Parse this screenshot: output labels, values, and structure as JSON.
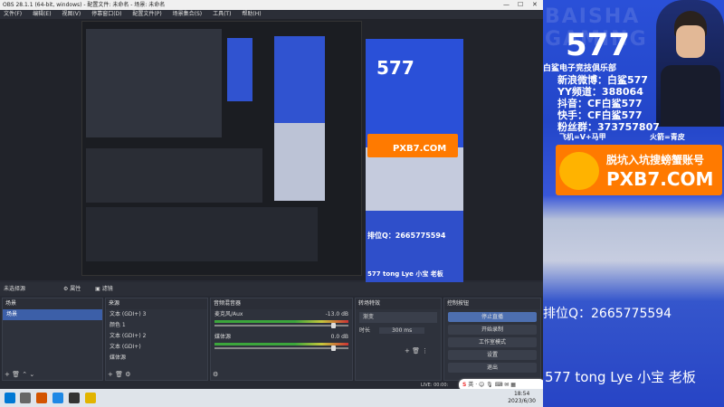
{
  "window": {
    "title": "OBS 28.1.1 (64-bit, windows) - 配置文件: 未命名 - 场景: 未命名"
  },
  "menu": [
    "文件(F)",
    "编辑(E)",
    "视图(V)",
    "停靠窗口(D)",
    "配置文件(P)",
    "场景集合(S)",
    "工具(T)",
    "帮助(H)"
  ],
  "source_bar": {
    "label": "未选择源",
    "properties": "属性",
    "filters": "滤镜"
  },
  "scenes": {
    "title": "场景",
    "items": [
      "场景"
    ]
  },
  "sources": {
    "title": "来源",
    "items": [
      "文本 (GDI+) 3",
      "颜色 1",
      "文本 (GDI+) 2",
      "文本 (GDI+)",
      "媒体源"
    ]
  },
  "mixer": {
    "title": "音频混音器",
    "channels": [
      {
        "name": "麦克风/Aux",
        "level": "-13.0 dB"
      },
      {
        "name": "媒体源",
        "level": "0.0 dB"
      }
    ]
  },
  "transitions": {
    "title": "转场特效",
    "type": "渐变",
    "duration_label": "时长",
    "duration": "300 ms"
  },
  "controls": {
    "title": "控制按钮",
    "buttons": [
      "停止直播",
      "开始录制",
      "工作室模式",
      "设置",
      "退出"
    ]
  },
  "status": {
    "live": "LIVE: 00:00:",
    "ime_label": "英"
  },
  "clock": {
    "time": "18:54",
    "date": "2023/6/30"
  },
  "stream": {
    "number": "577",
    "club": "白鲨电子竞技俱乐部",
    "lines": [
      "新浪微博：白鲨577",
      "YY频道：388064",
      "抖音：CF白鲨577",
      "快手：CF白鲨577",
      "粉丝群：373757807"
    ],
    "social": [
      "飞机=V+马甲",
      "火箭=青皮"
    ],
    "slogan": "脱坑入坑搜螃蟹账号",
    "site": "PXB7.COM",
    "qq": "排位Q：2665775594",
    "footer": "577 tong Lye 小宝 老板",
    "watermark": "BAISHA GAMING"
  },
  "colors": {
    "accent": "#2a50d8",
    "banner": "#ff7a00",
    "text_yellow": "#ffe23c"
  }
}
